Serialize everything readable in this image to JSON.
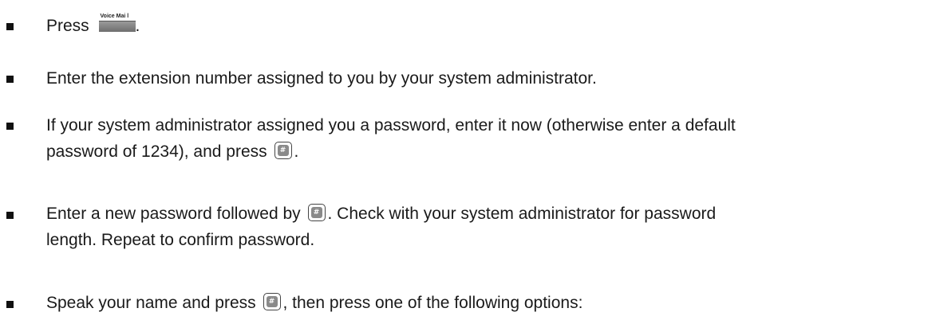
{
  "steps": [
    {
      "before": "Press ",
      "softkey_label": "Voice Mai  l",
      "after": "."
    },
    {
      "text": "Enter the extension number assigned to you by your system administrator."
    },
    {
      "line1": "If your system administrator assigned you a password, enter it now (otherwise enter a default",
      "line2_before": "password of 1234), and press ",
      "line2_after": "."
    },
    {
      "line1_before": "Enter a new password followed by ",
      "line1_after": ". Check with your system administrator for password",
      "line2": "length. Repeat to confirm password."
    },
    {
      "before": "Speak your name and press ",
      "after": ", then press one of the following options:"
    }
  ],
  "key_hash_symbol": "#"
}
